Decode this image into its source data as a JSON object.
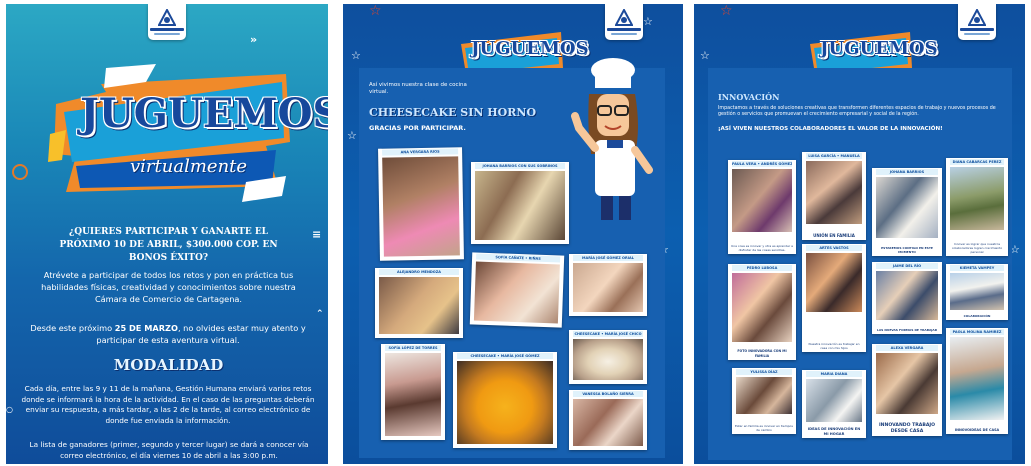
{
  "panel1": {
    "logo": {
      "name": "camara-comercio-logo"
    },
    "title": {
      "main": "JUGUEMOS",
      "sub": "virtualmente"
    },
    "question": "¿QUIERES PARTICIPAR Y GANARTE EL PRÓXIMO 10 DE ABRIL, $300.000 COP. EN BONOS ÉXITO?",
    "intro": "Atrévete a participar de todos los retos y pon en práctica tus habilidades físicas, creatividad y conocimientos sobre nuestra Cámara de Comercio de Cartagena.",
    "date_prefix": "Desde este próximo ",
    "date_bold": "25 DE MARZO",
    "date_suffix": ", no olvides estar muy atento y participar de esta aventura virtual.",
    "modalidad_heading": "MODALIDAD",
    "modalidad_body": "Cada día, entre las 9 y 11 de la mañana, Gestión Humana enviará varios retos donde se informará la hora de la actividad. En el caso de las preguntas deberán enviar su respuesta, a más tardar, a las 2 de la tarde, al correo electrónico de donde fue enviada la información.",
    "winners": "La lista de ganadores (primer, segundo y tercer lugar) se dará a conocer vía correo electrónico, el día viernes 10 de abril a las 3:00 p.m."
  },
  "panel2": {
    "title": {
      "main": "JUGUEMOS",
      "sub": "virtualmente"
    },
    "intro": "Así vivimos nuestra clase de cocina virtual.",
    "heading": "CHEESECAKE SIN HORNO",
    "thanks": "GRACIAS POR PARTICIPAR.",
    "photos": [
      {
        "label": "ANA VERGARA RIOS"
      },
      {
        "label": "JOHANA BARRIOS CON SUS SOBRINOS"
      },
      {
        "label": "ALEJANDRO MENDOZA"
      },
      {
        "label": "SOFÍA CAÑATE • RIÑAS"
      },
      {
        "label": "MARÍA JOSÉ GÓMEZ ORIAL"
      },
      {
        "label": "SOFÍA LÓPEZ DE TORRES"
      },
      {
        "label": "CHEESECAKE • MARÍA JOSÉ GÓMEZ"
      },
      {
        "label": "CHEESECAKE • MARÍA JOSÉ CHICO"
      },
      {
        "label": "VANESSA BOLAÑO SIERRA"
      }
    ]
  },
  "panel3": {
    "title": {
      "main": "JUGUEMOS",
      "sub": "virtualmente"
    },
    "heading": "INNOVACIÓN",
    "body": "Impactamos a través de soluciones creativas que transformen diferentes espacios de trabajo y nuevos procesos de gestión o servicios que promuevan el crecimiento empresarial y social de la región.",
    "tagline": "¡ASÍ VIVEN NUESTROS COLABORADORES EL VALOR DE LA INNOVACIÓN!",
    "photos": [
      {
        "label": "PAULA VERA • ANDRÉS GÓMEZ",
        "caption": "Una cosa es innovar y otra es aprender a disfrutar de las cosas sencillas."
      },
      {
        "label": "LUISA GARCÍA • MANUELA",
        "caption": "UNIÓN EN FAMILIA"
      },
      {
        "label": "JOHANA BARRIOS",
        "caption": "ESTAREMOS CONTIGO EN ESTE MOMENTO"
      },
      {
        "label": "DIANA CABARCAS PEREZ",
        "caption": "Innovar es lograr que nuestros colaboradores logren crecimiento personal"
      },
      {
        "label": "PEDRO LUBOSA",
        "caption": "FOTO INNOVADORA CON MI FAMILIA"
      },
      {
        "label": "ARTES VASTOS",
        "caption": "Nuestra innovación es trabajar en casa con mis hijos"
      },
      {
        "label": "JAIME DEL RÍO",
        "caption": "LAS NUEVAS FORMAS DE TRABAJAR"
      },
      {
        "label": "KIEMETA VAMPEY",
        "caption": "COLABORACIÓN"
      },
      {
        "label": "YULISSA DÍAZ",
        "caption": "Estar en familia es innovar en tiempos de cambio"
      },
      {
        "label": "MARIA DIANA",
        "caption": "IDEAS DE INNOVACIÓN EN MI HOGAR"
      },
      {
        "label": "ALEXA VERGARA",
        "caption": "INNOVANDO TRABAJO DESDE CASA"
      },
      {
        "label": "PAOLA MOLINA RAMIREZ",
        "caption": "INNOVOIDEAS DE CASA"
      }
    ]
  },
  "colors": {
    "brand_blue": "#17489c",
    "cyan": "#2ca8c4",
    "orange": "#f08a2a",
    "white": "#ffffff"
  }
}
